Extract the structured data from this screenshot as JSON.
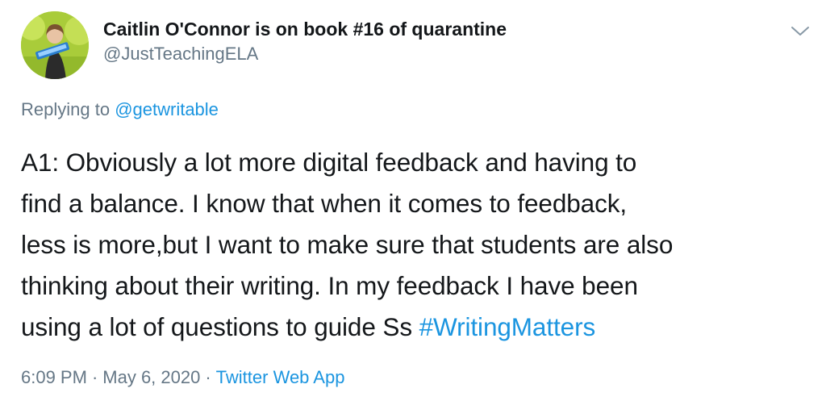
{
  "author": {
    "display_name": "Caitlin O'Connor is on book #16 of quarantine",
    "handle": "@JustTeachingELA",
    "avatar_icon": "profile-photo"
  },
  "reply": {
    "prefix": "Replying to ",
    "to_handle": "@getwritable"
  },
  "body": {
    "lines": [
      "A1: Obviously a lot more digital feedback and having to",
      "find a balance. I know that when it comes to feedback,",
      "less is more,but I want to make sure that students are also",
      "thinking about their writing. In my feedback I have been",
      "using a lot of questions to guide Ss "
    ],
    "hashtag": "#WritingMatters"
  },
  "meta": {
    "time": "6:09 PM",
    "separator": "·",
    "date": "May 6, 2020",
    "source": "Twitter Web App"
  },
  "menu": {
    "icon": "chevron-down-icon"
  },
  "colors": {
    "link": "#1b95e0",
    "secondary_text": "#657786",
    "primary_text": "#14171a",
    "background": "#ffffff"
  }
}
